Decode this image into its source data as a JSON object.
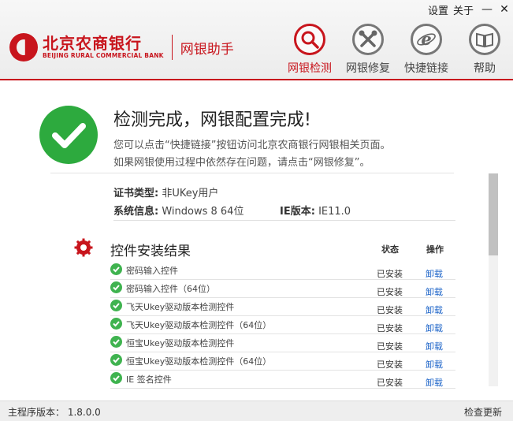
{
  "window": {
    "settings_label": "设置",
    "about_label": "关于",
    "minimize_glyph": "—",
    "close_glyph": "✕"
  },
  "brand": {
    "name_cn": "北京农商银行",
    "name_en": "BEIJING RURAL COMMERCIAL BANK",
    "app_name": "网银助手",
    "color": "#c8151d"
  },
  "nav": [
    {
      "label": "网银检测",
      "icon": "magnifier-icon",
      "active": true
    },
    {
      "label": "网银修复",
      "icon": "tools-icon",
      "active": false
    },
    {
      "label": "快捷链接",
      "icon": "ie-icon",
      "active": false
    },
    {
      "label": "帮助",
      "icon": "book-icon",
      "active": false
    }
  ],
  "result": {
    "title": "检测完成，网银配置完成!",
    "desc1": "您可以点击“快捷链接”按钮访问北京农商银行网银相关页面。",
    "desc2": "如果网银使用过程中依然存在问题，请点击“网银修复”。"
  },
  "info": {
    "cert_label": "证书类型:",
    "cert_value": "非UKey用户",
    "sys_label": "系统信息:",
    "sys_value": "Windows 8 64位",
    "ie_label": "IE版本:",
    "ie_value": "IE11.0"
  },
  "controls": {
    "title": "控件安装结果",
    "status_header": "状态",
    "action_header": "操作",
    "rows": [
      {
        "name": "密码输入控件",
        "status": "已安装",
        "action": "卸载"
      },
      {
        "name": "密码输入控件（64位）",
        "status": "已安装",
        "action": "卸载"
      },
      {
        "name": "飞天Ukey驱动版本检测控件",
        "status": "已安装",
        "action": "卸载"
      },
      {
        "name": "飞天Ukey驱动版本检测控件（64位）",
        "status": "已安装",
        "action": "卸载"
      },
      {
        "name": "恒宝Ukey驱动版本检测控件",
        "status": "已安装",
        "action": "卸载"
      },
      {
        "name": "恒宝Ukey驱动版本检测控件（64位）",
        "status": "已安装",
        "action": "卸载"
      },
      {
        "name": "IE 签名控件",
        "status": "已安装",
        "action": "卸载"
      }
    ]
  },
  "footer": {
    "version_text": "主程序版本： 1.8.0.0",
    "update_label": "检查更新"
  }
}
